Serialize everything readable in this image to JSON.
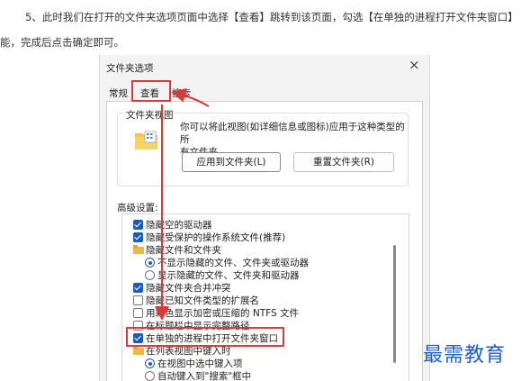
{
  "instructions": {
    "line1": "5、此时我们在打开的文件夹选项页面中选择【查看】跳转到该页面，勾选【在单独的进程打开文件夹窗口】",
    "line2": "能，完成后点击确定即可。"
  },
  "dialog": {
    "title": "文件夹选项",
    "close_icon": "×",
    "tabs": [
      "常规",
      "查看",
      "搜索"
    ],
    "folder_views": {
      "group_label": "文件夹视图",
      "description_line1": "你可以将此视图(如详细信息或图标)应用于这种类型的所",
      "description_line2": "有文件夹。",
      "apply_button": "应用到文件夹(L)",
      "reset_button": "重置文件夹(R)"
    },
    "advanced_label": "高级设置:",
    "advanced_items": [
      {
        "text": "隐藏空的驱动器",
        "control": "checkbox",
        "checked": true
      },
      {
        "text": "隐藏受保护的操作系统文件(推荐)",
        "control": "checkbox",
        "checked": true
      },
      {
        "text": "隐藏文件和文件夹",
        "control": "folder"
      },
      {
        "text": "不显示隐藏的文件、文件夹或驱动器",
        "control": "radio",
        "checked": true
      },
      {
        "text": "显示隐藏的文件、文件夹和驱动器",
        "control": "radio",
        "checked": false
      },
      {
        "text": "隐藏文件夹合并冲突",
        "control": "checkbox",
        "checked": true
      },
      {
        "text": "隐藏已知文件类型的扩展名",
        "control": "checkbox",
        "checked": false
      },
      {
        "text": "用彩色显示加密或压缩的 NTFS 文件",
        "control": "checkbox",
        "checked": false
      },
      {
        "text": "在标题栏中显示完整路径",
        "control": "checkbox",
        "checked": false
      },
      {
        "text": "在单独的进程中打开文件夹窗口",
        "control": "checkbox",
        "checked": true
      },
      {
        "text": "在列表视图中键入时",
        "control": "folder"
      },
      {
        "text": "在视图中选中键入项",
        "control": "radio",
        "checked": true
      },
      {
        "text": "自动键入到\"搜索\"框中",
        "control": "radio",
        "checked": false
      }
    ]
  },
  "annotation_color": "#d93a3a",
  "watermark": "最需教育"
}
